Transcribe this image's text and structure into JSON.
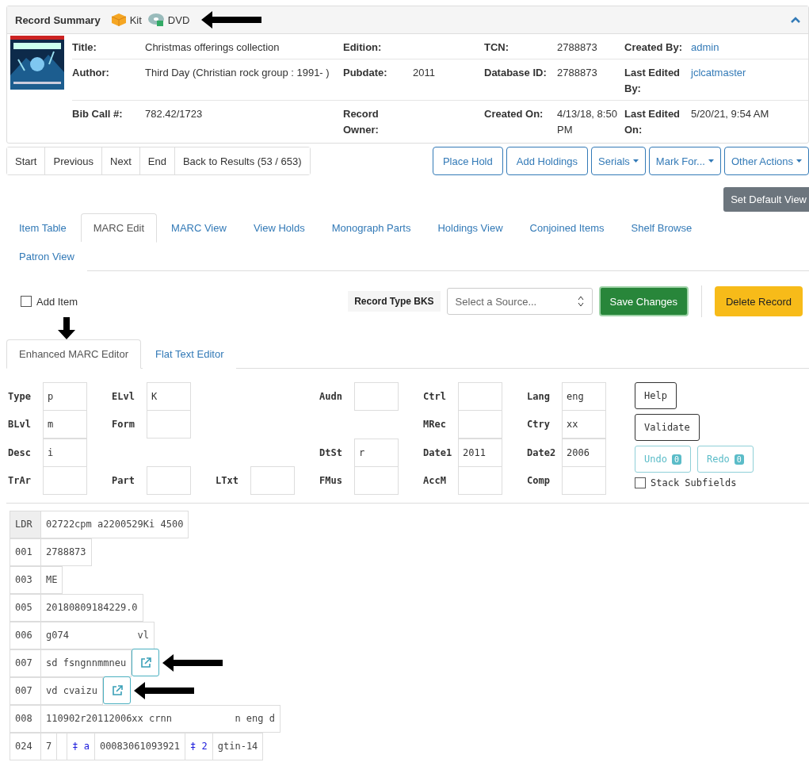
{
  "summary": {
    "title": "Record Summary",
    "formats": [
      {
        "kind": "kit",
        "label": "Kit"
      },
      {
        "kind": "dvd",
        "label": "DVD"
      }
    ],
    "expanded": true,
    "rows": [
      [
        {
          "label": "Title:",
          "value": "Christmas offerings collection"
        },
        {
          "label": "Edition:"
        },
        {
          "label": "TCN:",
          "value": "2788873"
        },
        {
          "label": "Created By:",
          "value": "admin",
          "link": true
        }
      ],
      [
        {
          "label": "Author:",
          "value": "Third Day (Christian rock group : 1991- )"
        },
        {
          "label": "Pubdate:",
          "value": "2011"
        },
        {
          "label": "Database ID:",
          "value": "2788873"
        },
        {
          "label": "Last Edited By:",
          "value": "jclcatmaster",
          "link": true
        }
      ],
      [
        {
          "label": "Bib Call #:",
          "value": "782.42/1723"
        },
        {
          "label": "Record Owner:"
        },
        {
          "label": "Created On:",
          "value": "4/13/18, 8:50 PM"
        },
        {
          "label": "Last Edited On:",
          "value": "5/20/21, 9:54 AM"
        }
      ]
    ]
  },
  "nav_buttons": [
    "Start",
    "Previous",
    "Next",
    "End",
    "Back to Results (53 / 653)"
  ],
  "action_buttons": [
    {
      "label": "Place Hold",
      "dropdown": false
    },
    {
      "label": "Add Holdings",
      "dropdown": false
    },
    {
      "label": "Serials",
      "dropdown": true
    },
    {
      "label": "Mark For...",
      "dropdown": true
    },
    {
      "label": "Other Actions",
      "dropdown": true
    }
  ],
  "set_default_view": "Set Default View",
  "tabs": [
    {
      "label": "Item Table",
      "selected": false
    },
    {
      "label": "MARC Edit",
      "selected": true
    },
    {
      "label": "MARC View",
      "selected": false
    },
    {
      "label": "View Holds",
      "selected": false
    },
    {
      "label": "Monograph Parts",
      "selected": false
    },
    {
      "label": "Holdings View",
      "selected": false
    },
    {
      "label": "Conjoined Items",
      "selected": false
    },
    {
      "label": "Shelf Browse",
      "selected": false
    },
    {
      "label": "Patron View",
      "selected": false
    }
  ],
  "toolbar": {
    "add_item": {
      "label": "Add Item",
      "checked": false
    },
    "record_type": "Record Type BKS",
    "source_select": {
      "placeholder": "Select a Source..."
    },
    "save": "Save Changes",
    "delete": "Delete Record"
  },
  "editor_tabs": [
    {
      "label": "Enhanced MARC Editor",
      "selected": true
    },
    {
      "label": "Flat Text Editor",
      "selected": false
    }
  ],
  "fixed_fields": [
    [
      {
        "kind": "field",
        "label": "Type",
        "value": "p"
      },
      {
        "kind": "field",
        "label": "ELvl",
        "value": "K"
      },
      {
        "kind": "gap"
      },
      {
        "kind": "field",
        "label": "Audn"
      },
      {
        "kind": "field",
        "label": "Ctrl"
      },
      {
        "kind": "field",
        "label": "Lang",
        "value": "eng"
      }
    ],
    [
      {
        "kind": "field",
        "label": "BLvl",
        "value": "m"
      },
      {
        "kind": "field",
        "label": "Form"
      },
      {
        "kind": "gap"
      },
      {
        "kind": "gap"
      },
      {
        "kind": "field",
        "label": "MRec"
      },
      {
        "kind": "field",
        "label": "Ctry",
        "value": "xx"
      }
    ],
    [
      {
        "kind": "field",
        "label": "Desc",
        "value": "i"
      },
      {
        "kind": "gap"
      },
      {
        "kind": "gap"
      },
      {
        "kind": "field",
        "label": "DtSt",
        "value": "r"
      },
      {
        "kind": "field",
        "label": "Date1",
        "value": "2011"
      },
      {
        "kind": "field",
        "label": "Date2",
        "value": "2006"
      }
    ],
    [
      {
        "kind": "field",
        "label": "TrAr"
      },
      {
        "kind": "field",
        "label": "Part"
      },
      {
        "kind": "field",
        "label": "LTxt"
      },
      {
        "kind": "field",
        "label": "FMus"
      },
      {
        "kind": "field",
        "label": "AccM"
      },
      {
        "kind": "field",
        "label": "Comp"
      }
    ]
  ],
  "editor_buttons": {
    "help": "Help",
    "validate": "Validate",
    "undo": {
      "label": "Undo",
      "count": "0",
      "disabled": true
    },
    "redo": {
      "label": "Redo",
      "count": "0",
      "disabled": true
    },
    "stack_subfields": {
      "label": "Stack Subfields",
      "checked": false
    }
  },
  "marc": [
    {
      "kind": "leader",
      "tag": "LDR",
      "value": "02722cpm a2200529Ki 4500"
    },
    {
      "kind": "control",
      "tag": "001",
      "value": "2788873"
    },
    {
      "kind": "control",
      "tag": "003",
      "value": "ME"
    },
    {
      "kind": "control",
      "tag": "005",
      "value": "20180809184229.0"
    },
    {
      "kind": "control",
      "tag": "006",
      "value": "g074            vl"
    },
    {
      "kind": "control",
      "tag": "007",
      "value": "sd fsngnnmmneu",
      "edit_button": true
    },
    {
      "kind": "control",
      "tag": "007",
      "value": "vd cvaizu",
      "edit_button": true
    },
    {
      "kind": "control",
      "tag": "008",
      "value": "110902r20112006xx crnn           n eng d"
    },
    {
      "kind": "data",
      "tag": "024",
      "ind1": "7",
      "subfields": [
        {
          "code": "‡ a",
          "value": "00083061093921"
        },
        {
          "code": "‡ 2",
          "value": "gtin-14"
        }
      ]
    }
  ]
}
